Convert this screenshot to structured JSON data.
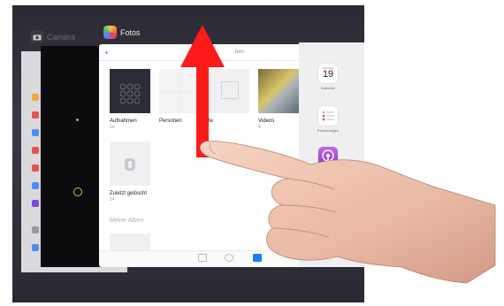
{
  "cards": {
    "camera_label": "Camera",
    "photos_label": "Fotos"
  },
  "photos": {
    "add_symbol": "+",
    "header_title_fragment": "ben",
    "albums": [
      {
        "name": "Aufnahmen",
        "count": "19"
      },
      {
        "name": "Personen",
        "count": ""
      },
      {
        "name": "te",
        "count": ""
      },
      {
        "name": "Videos",
        "count": "6"
      },
      {
        "name": "Zuletzt gelöscht",
        "count": "24"
      }
    ],
    "section_header": "Meine Alben"
  },
  "right_card": {
    "calendar_weekday": "Dienstag",
    "calendar_day": "19",
    "calendar_label": "Kalender",
    "reminders_label": "Erinnerungen"
  },
  "colors": {
    "arrow": "#ff1a1a",
    "ios_blue": "#1a7cff",
    "podcast_purple": "#a24bd8"
  },
  "icons": [
    "photos-app-icon",
    "camera-app-icon",
    "calendar-app-icon",
    "reminders-app-icon",
    "podcasts-app-icon",
    "up-arrow",
    "pointing-hand"
  ]
}
